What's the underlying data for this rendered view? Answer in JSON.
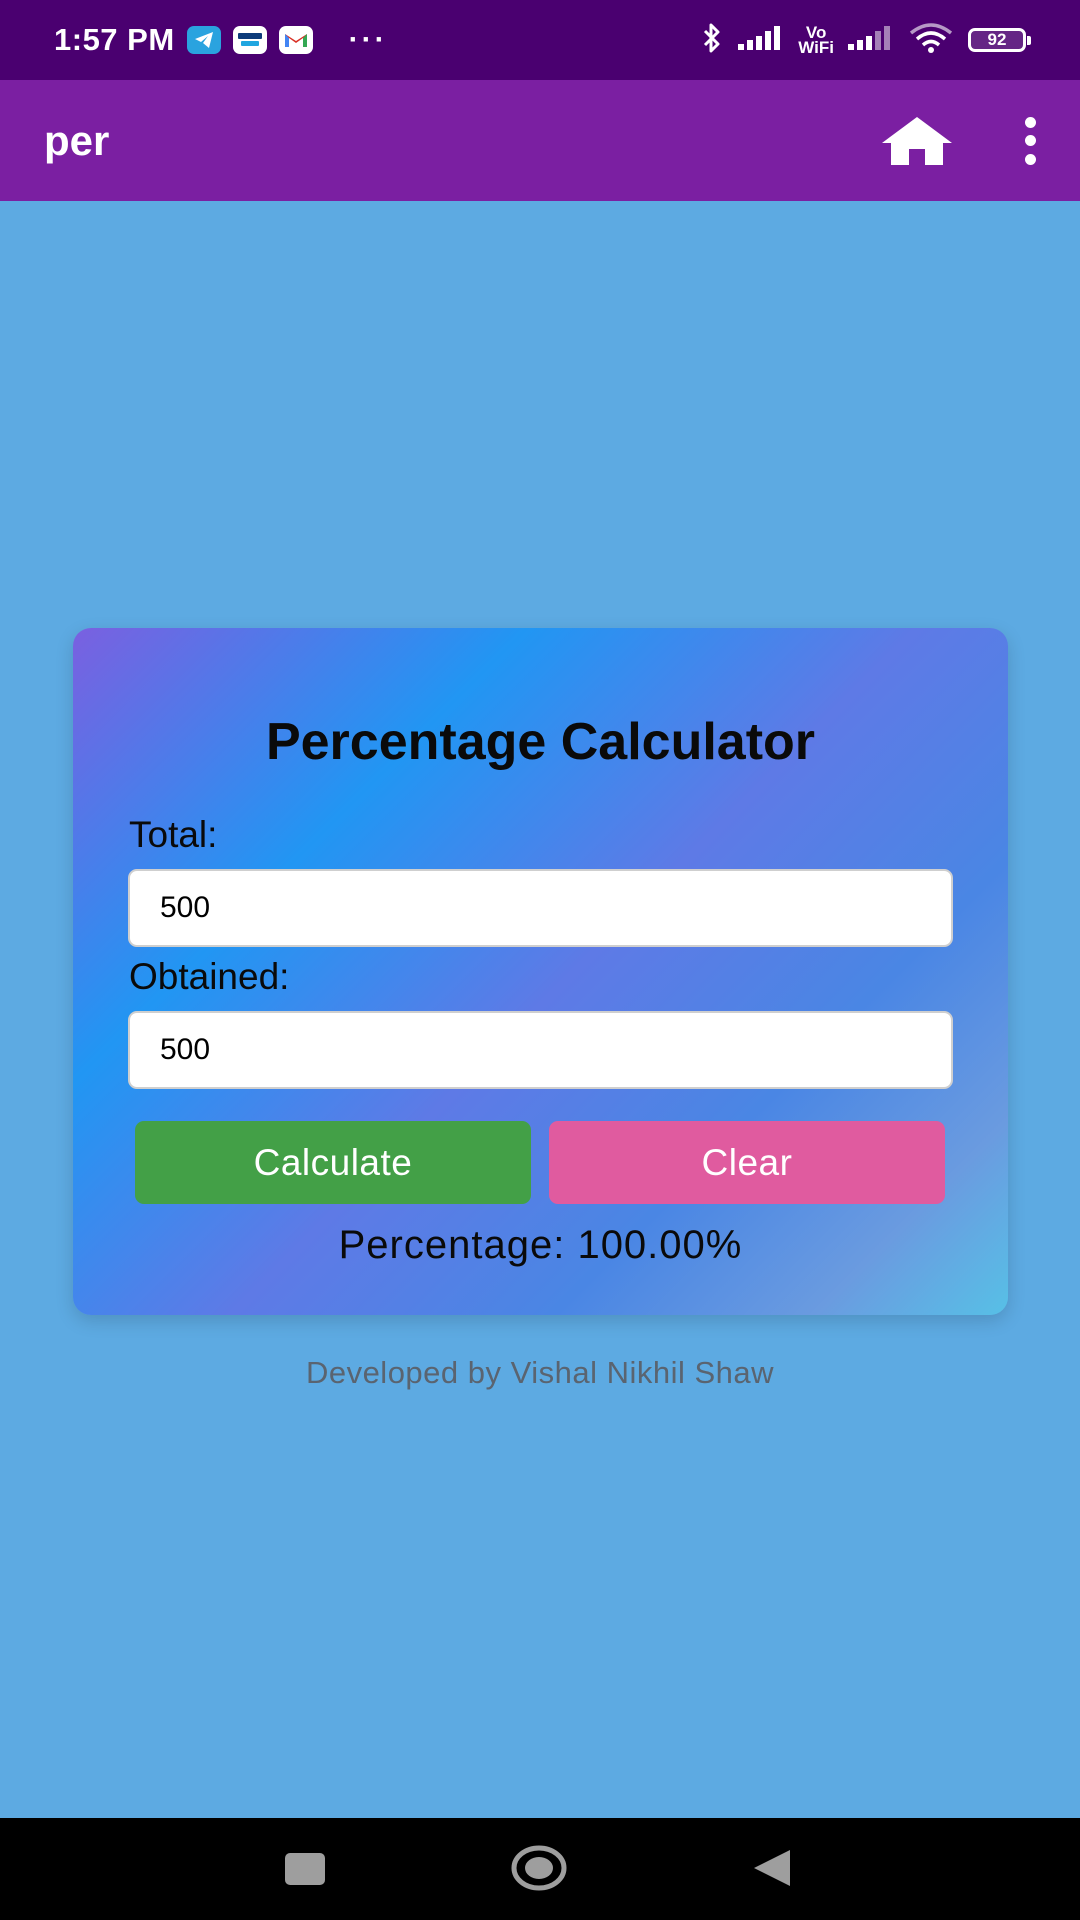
{
  "status_bar": {
    "time": "1:57 PM",
    "notification_icons": [
      "telegram-icon",
      "paytm-icon",
      "gmail-icon"
    ],
    "overflow": "···",
    "vowifi_label_top": "Vo",
    "vowifi_label_bottom": "WiFi",
    "battery_level": "92"
  },
  "app_bar": {
    "title": "per",
    "home_icon": "home-icon",
    "menu_icon": "more-vertical-icon"
  },
  "calculator": {
    "title": "Percentage Calculator",
    "total_label": "Total:",
    "total_value": "500",
    "obtained_label": "Obtained:",
    "obtained_value": "500",
    "calculate_label": "Calculate",
    "clear_label": "Clear",
    "result_text": "Percentage: 100.00%"
  },
  "footer": {
    "credit": "Developed by Vishal Nikhil Shaw"
  },
  "nav_bar": {
    "recent_icon": "recent-apps-icon",
    "home_icon": "nav-home-icon",
    "back_icon": "back-icon"
  },
  "colors": {
    "status_bar": "#4a0070",
    "app_bar": "#7b1fa2",
    "background": "#5daae2",
    "calculate_button": "#43a047",
    "clear_button": "#e05b9f"
  }
}
